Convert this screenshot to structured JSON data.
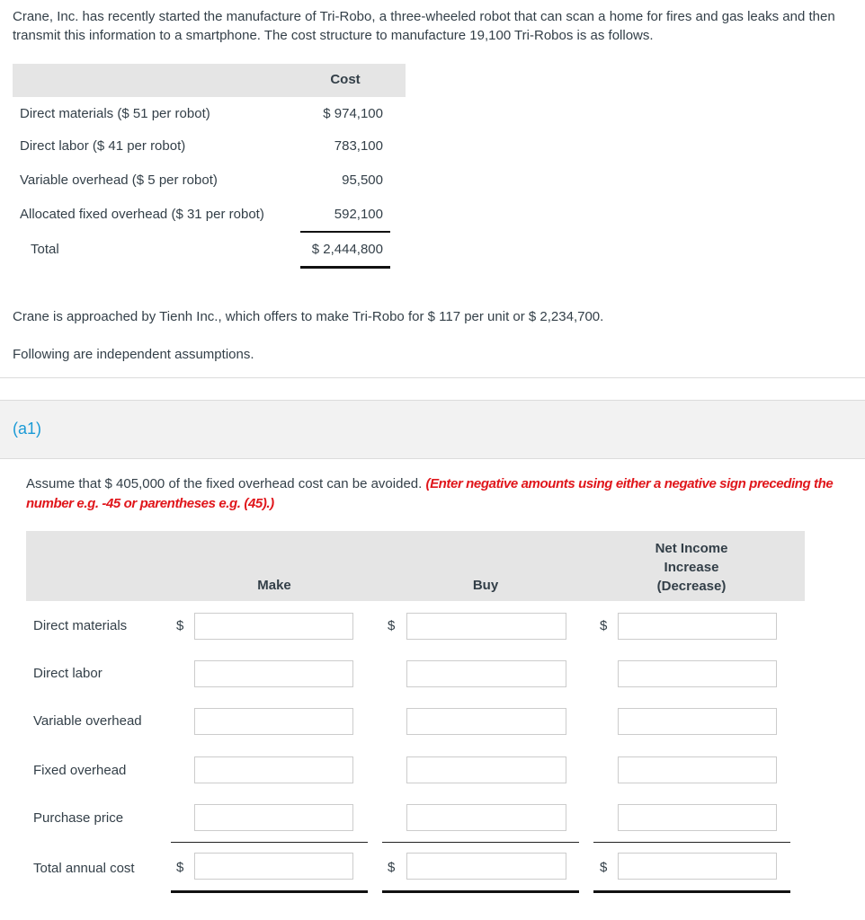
{
  "intro": "Crane, Inc. has recently started the manufacture of Tri-Robo, a three-wheeled robot that can scan a home for fires and gas leaks and then transmit this information to a smartphone. The cost structure to manufacture 19,100 Tri-Robos is as follows.",
  "cost_table": {
    "header": "Cost",
    "rows": [
      {
        "label": "Direct materials ($ 51 per robot)",
        "value": "$ 974,100"
      },
      {
        "label": "Direct labor ($ 41 per robot)",
        "value": "783,100"
      },
      {
        "label": "Variable overhead ($ 5 per robot)",
        "value": "95,500"
      },
      {
        "label": "Allocated fixed overhead ($ 31 per robot)",
        "value": "592,100"
      }
    ],
    "total": {
      "label": "Total",
      "value": "$ 2,444,800"
    }
  },
  "offer_text": "Crane is approached by Tienh Inc., which offers to make Tri-Robo for $ 117 per unit or $ 2,234,700.",
  "assumptions_text": "Following are independent assumptions.",
  "part": {
    "label": "(a1)",
    "instruction": "Assume that $ 405,000 of the fixed overhead cost can be avoided.",
    "note": "(Enter negative amounts using either a negative sign preceding the number e.g. -45 or parentheses e.g. (45).)"
  },
  "analysis_table": {
    "columns": [
      "Make",
      "Buy",
      "Net Income Increase (Decrease)"
    ],
    "currency_symbol": "$",
    "rows": [
      {
        "label": "Direct materials",
        "values": [
          "",
          "",
          ""
        ]
      },
      {
        "label": "Direct labor",
        "values": [
          "",
          "",
          ""
        ]
      },
      {
        "label": "Variable overhead",
        "values": [
          "",
          "",
          ""
        ]
      },
      {
        "label": "Fixed overhead",
        "values": [
          "",
          "",
          ""
        ]
      },
      {
        "label": "Purchase price",
        "values": [
          "",
          "",
          ""
        ]
      },
      {
        "label": "Total annual cost",
        "values": [
          "",
          "",
          ""
        ]
      }
    ]
  },
  "colors": {
    "part_label": "#1a9ad6",
    "note_red": "#e0161b",
    "header_bg": "#e5e5e5"
  }
}
